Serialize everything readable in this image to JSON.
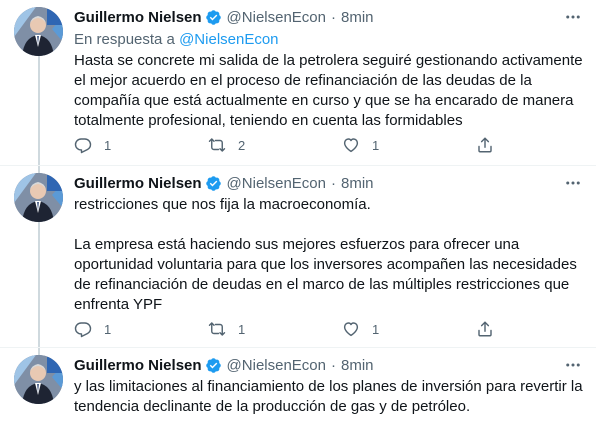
{
  "tweets": [
    {
      "author_name": "Guillermo Nielsen",
      "handle": "@NielsenEcon",
      "separator": "·",
      "time": "8min",
      "reply_prefix": "En respuesta a",
      "reply_mention": "@NielsenEcon",
      "paragraphs": [
        "Hasta se concrete mi salida de la petrolera seguiré gestionando activamente el mejor acuerdo en el proceso de refinanciación de las deudas de la compañía que está actualmente en curso y que se ha encarado de manera totalmente profesional, teniendo en cuenta las formidables"
      ],
      "replies": "1",
      "retweets": "2",
      "likes": "1"
    },
    {
      "author_name": "Guillermo Nielsen",
      "handle": "@NielsenEcon",
      "separator": "·",
      "time": "8min",
      "paragraphs": [
        "restricciones que nos fija la macroeconomía.",
        "La empresa está haciendo sus mejores esfuerzos para ofrecer una oportunidad voluntaria para que los inversores acompañen las necesidades de refinanciación de deudas en el marco de las múltiples restricciones que enfrenta YPF"
      ],
      "replies": "1",
      "retweets": "1",
      "likes": "1"
    },
    {
      "author_name": "Guillermo Nielsen",
      "handle": "@NielsenEcon",
      "separator": "·",
      "time": "8min",
      "paragraphs": [
        "y las limitaciones al financiamiento de los planes de inversión para revertir la tendencia declinante de la producción de gas y de petróleo."
      ]
    }
  ],
  "colors": {
    "text_primary": "#0f1419",
    "text_secondary": "#536471",
    "accent": "#1d9bf0",
    "thread_line": "#cfd9de",
    "divider": "#eff3f4"
  },
  "icons": [
    "verified-badge-icon",
    "more-icon",
    "reply-icon",
    "retweet-icon",
    "like-icon",
    "share-icon"
  ]
}
